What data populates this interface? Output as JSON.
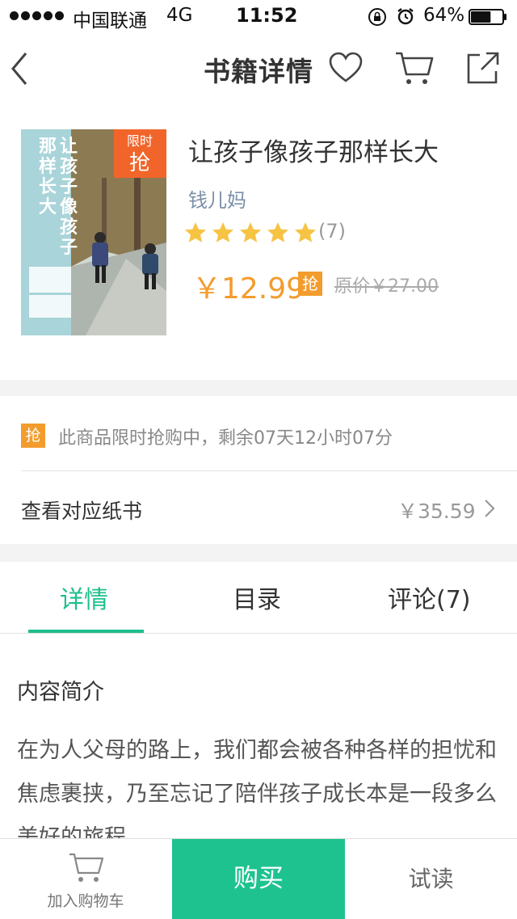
{
  "status_bar": {
    "carrier": "中国联通",
    "network": "4G",
    "time": "11:52",
    "battery": "64%",
    "battery_level": 0.64
  },
  "nav": {
    "title": "书籍详情",
    "icons": [
      "back-chevron-icon",
      "heart-icon",
      "cart-icon",
      "share-icon"
    ]
  },
  "book": {
    "title": "让孩子像孩子那样长大",
    "author": "钱儿妈",
    "rating_stars": 5,
    "rating_count": "(7)",
    "price": "￥12.99",
    "flash_badge": "抢",
    "original_price": "原价￥27.00",
    "cover": {
      "flash_label_line1": "限时",
      "flash_label_line2": "抢",
      "title_col1": "让孩子像孩子",
      "title_col2": "那样长大"
    }
  },
  "flash_sale": {
    "badge": "抢",
    "text": "此商品限时抢购中，剩余07天12小时07分"
  },
  "paper_book": {
    "label": "查看对应纸书",
    "price": "￥35.59"
  },
  "tabs": [
    {
      "label": "详情",
      "active": true
    },
    {
      "label": "目录",
      "active": false
    },
    {
      "label": "评论(7)",
      "active": false
    }
  ],
  "content": {
    "section_title": "内容简介",
    "intro": "在为人父母的路上，我们都会被各种各样的担忧和焦虑裹挟，乃至忘记了陪伴孩子成长本是一段多么美好的旅程。"
  },
  "bottom_bar": {
    "add_to_cart": "加入购物车",
    "buy": "购买",
    "trial": "试读"
  },
  "colors": {
    "accent_green": "#1ec28f",
    "price_orange": "#f39c2e",
    "star_yellow": "#f6c343",
    "author_blue": "#7a8fa8"
  }
}
